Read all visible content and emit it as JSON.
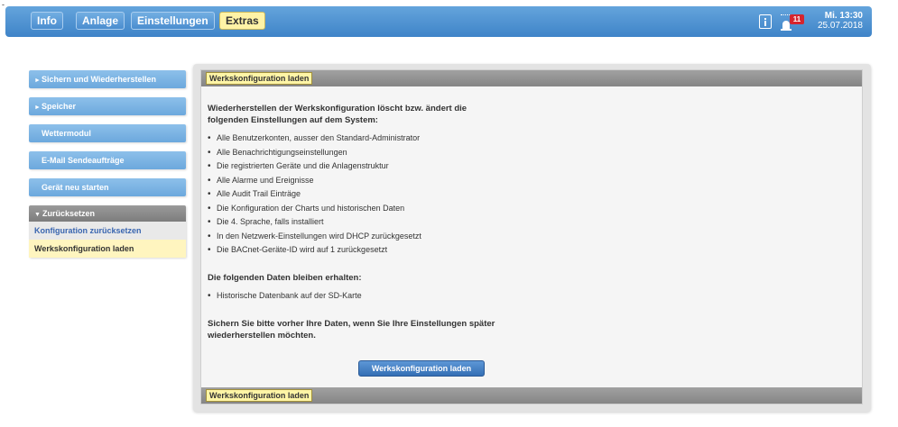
{
  "corner_mark": "-",
  "topnav": {
    "tabs": [
      {
        "label": "Info"
      },
      {
        "label": "Anlage"
      },
      {
        "label": "Einstellungen"
      },
      {
        "label": "Extras"
      }
    ],
    "alarm_count": "11",
    "clock_time": "Mi. 13:30",
    "clock_date": "25.07.2018"
  },
  "sidebar": {
    "items": [
      {
        "label": "Sichern und Wiederherstellen"
      },
      {
        "label": "Speicher"
      },
      {
        "label": "Wettermodul"
      },
      {
        "label": "E-Mail Sendeaufträge"
      },
      {
        "label": "Gerät neu starten"
      }
    ],
    "group": {
      "label": "Zurücksetzen",
      "children": [
        {
          "label": "Konfiguration zurücksetzen"
        },
        {
          "label": "Werkskonfiguration laden"
        }
      ]
    }
  },
  "main": {
    "header_label": "Werkskonfiguration laden",
    "intro": "Wiederherstellen der Werkskonfiguration löscht bzw. ändert die folgenden Einstellungen auf dem System:",
    "changes": [
      "Alle Benutzerkonten, ausser den Standard-Administrator",
      "Alle Benachrichtigungseinstellungen",
      "Die registrierten Geräte und die Anlagenstruktur",
      "Alle Alarme und Ereignisse",
      "Alle Audit Trail Einträge",
      "Die Konfiguration der Charts und historischen Daten",
      "Die 4. Sprache, falls installiert",
      "In den Netzwerk-Einstellungen wird DHCP zurückgesetzt",
      "Die BACnet-Geräte-ID wird auf 1 zurückgesetzt"
    ],
    "kept_title": "Die folgenden Daten bleiben erhalten:",
    "kept": [
      "Historische Datenbank auf der SD-Karte"
    ],
    "backup_note": "Sichern Sie bitte vorher Ihre Daten, wenn Sie Ihre Einstellungen später wiederherstellen möchten.",
    "button_label": "Werkskonfiguration laden",
    "footer_label": "Werkskonfiguration laden"
  },
  "colors": {
    "topbar": "#4b8dcf",
    "active_tab": "#fff3a6",
    "sidebar_item": "#7ab2e2",
    "selected_item": "#fff5bf",
    "alarm_badge": "#d6252e"
  },
  "icons": [
    "info-icon",
    "alarm-icon"
  ]
}
